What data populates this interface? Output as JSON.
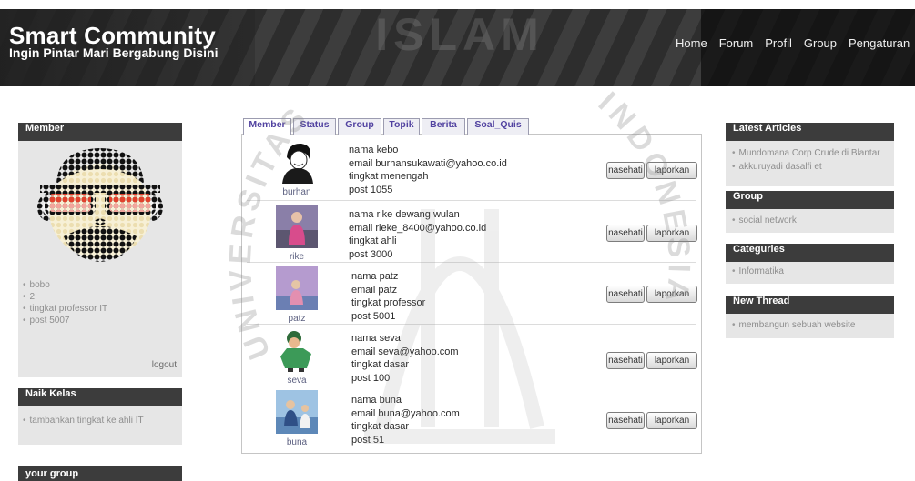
{
  "header": {
    "title": "Smart Community",
    "subtitle": "Ingin Pintar Mari Bergabung Disini",
    "nav": [
      "Home",
      "Forum",
      "Profil",
      "Group",
      "Pengaturan"
    ]
  },
  "left_sidebar": {
    "member": {
      "title": "Member",
      "items": [
        "bobo",
        "2",
        "tingkat professor IT",
        "post 5007"
      ],
      "logout": "logout"
    },
    "naik_kelas": {
      "title": "Naik Kelas",
      "items": [
        "tambahkan tingkat ke ahli IT"
      ]
    },
    "your_group": {
      "title": "your group"
    }
  },
  "main": {
    "tabs": [
      {
        "label": "Member",
        "active": true
      },
      {
        "label": "Status",
        "active": false
      },
      {
        "label": "Group",
        "active": false
      },
      {
        "label": "Topik",
        "active": false
      },
      {
        "label": "Berita",
        "active": false
      },
      {
        "label": "Soal_Quis",
        "active": false
      }
    ],
    "actions": {
      "advise": "nasehati",
      "report": "laporkan"
    },
    "members": [
      {
        "username": "burhan",
        "nama": "nama kebo",
        "email": "email burhansukawati@yahoo.co.id",
        "tingkat": "tingkat menengah",
        "post": "post 1055"
      },
      {
        "username": "rike",
        "nama": "nama rike dewang wulan",
        "email": "email rieke_8400@yahoo.co.id",
        "tingkat": "tingkat ahli",
        "post": "post 3000"
      },
      {
        "username": "patz",
        "nama": "nama patz",
        "email": "email patz",
        "tingkat": "tingkat professor",
        "post": "post 5001"
      },
      {
        "username": "seva",
        "nama": "nama seva",
        "email": "email seva@yahoo.com",
        "tingkat": "tingkat dasar",
        "post": "post 100"
      },
      {
        "username": "buna",
        "nama": "nama buna",
        "email": "email buna@yahoo.com",
        "tingkat": "tingkat dasar",
        "post": "post 51"
      }
    ]
  },
  "right_sidebar": {
    "latest_articles": {
      "title": "Latest Articles",
      "items": [
        "Mundomana Corp Crude di Blantar",
        "akkuruyadi dasalfi et"
      ]
    },
    "group": {
      "title": "Group",
      "items": [
        "social network"
      ]
    },
    "categories": {
      "title": "Categuries",
      "items": [
        "Informatika"
      ]
    },
    "new_thread": {
      "title": "New Thread",
      "items": [
        "membangun sebuah website"
      ]
    }
  },
  "watermark": {
    "top": "ISLAM",
    "left": "UNIVERSITAS",
    "right": "INDONESIA"
  },
  "colors": {
    "header_bg": "#2d2d2d",
    "sidebar_header_bg": "#3c3c3c",
    "sidebar_body_bg": "#e6e6e6",
    "tab_text": "#5142a0",
    "username_link": "#5c6080"
  }
}
